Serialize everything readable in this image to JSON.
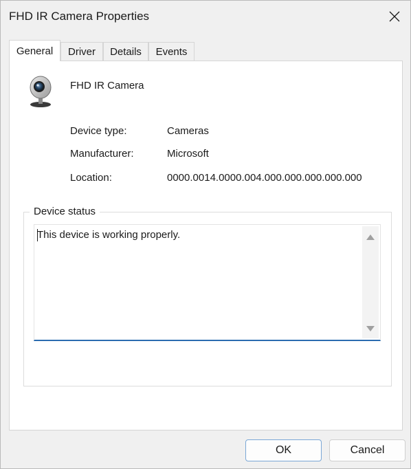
{
  "window": {
    "title": "FHD IR Camera Properties"
  },
  "tabs": [
    {
      "label": "General",
      "active": true
    },
    {
      "label": "Driver",
      "active": false
    },
    {
      "label": "Details",
      "active": false
    },
    {
      "label": "Events",
      "active": false
    }
  ],
  "device": {
    "icon": "webcam-icon",
    "name": "FHD IR Camera"
  },
  "properties": [
    {
      "label": "Device type:",
      "value": "Cameras"
    },
    {
      "label": "Manufacturer:",
      "value": "Microsoft"
    },
    {
      "label": "Location:",
      "value": "0000.0014.0000.004.000.000.000.000.000"
    }
  ],
  "status": {
    "group_label": "Device status",
    "text": "This device is working properly."
  },
  "buttons": {
    "ok": "OK",
    "cancel": "Cancel"
  },
  "colors": {
    "accent": "#2b6cb0",
    "window_bg": "#f0f0f0",
    "panel_bg": "#ffffff"
  }
}
